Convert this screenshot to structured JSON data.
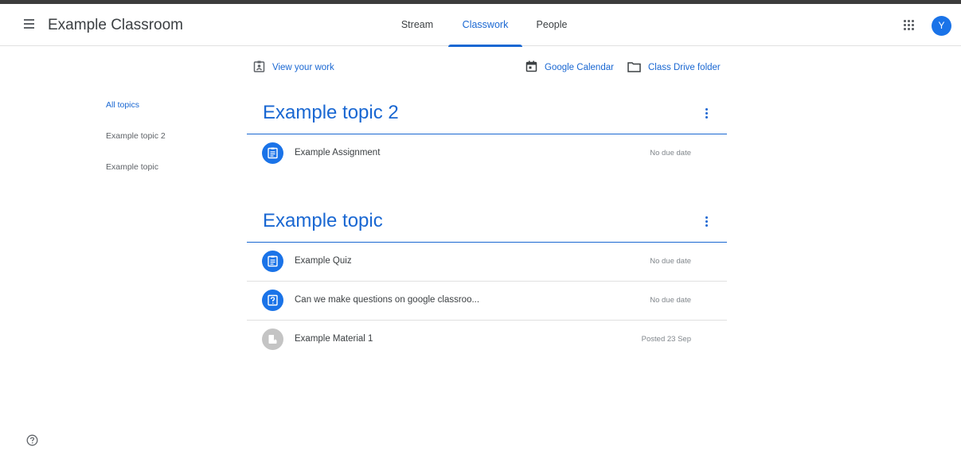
{
  "header": {
    "title": "Example Classroom",
    "tabs": [
      {
        "label": "Stream"
      },
      {
        "label": "Classwork"
      },
      {
        "label": "People"
      }
    ],
    "active_tab": "Classwork",
    "avatar_initial": "Y"
  },
  "links": {
    "view_work": "View your work",
    "google_calendar": "Google Calendar",
    "drive_folder": "Class Drive folder"
  },
  "sidebar": {
    "items": [
      {
        "label": "All topics"
      },
      {
        "label": "Example topic 2"
      },
      {
        "label": "Example topic"
      }
    ]
  },
  "topics": [
    {
      "title": "Example topic 2",
      "items": [
        {
          "title": "Example Assignment",
          "meta": "No due date",
          "icon": "assignment-icon"
        }
      ]
    },
    {
      "title": "Example topic",
      "items": [
        {
          "title": "Example Quiz",
          "meta": "No due date",
          "icon": "assignment-icon"
        },
        {
          "title": "Can we make questions on google classroo...",
          "meta": "No due date",
          "icon": "question-icon"
        },
        {
          "title": "Example Material 1",
          "meta": "Posted 23 Sep",
          "icon": "material-icon"
        }
      ]
    }
  ],
  "colors": {
    "accent": "#1967d2",
    "item_icon_bg": "#1a73e8",
    "material_icon_bg": "#c4c4c4"
  }
}
